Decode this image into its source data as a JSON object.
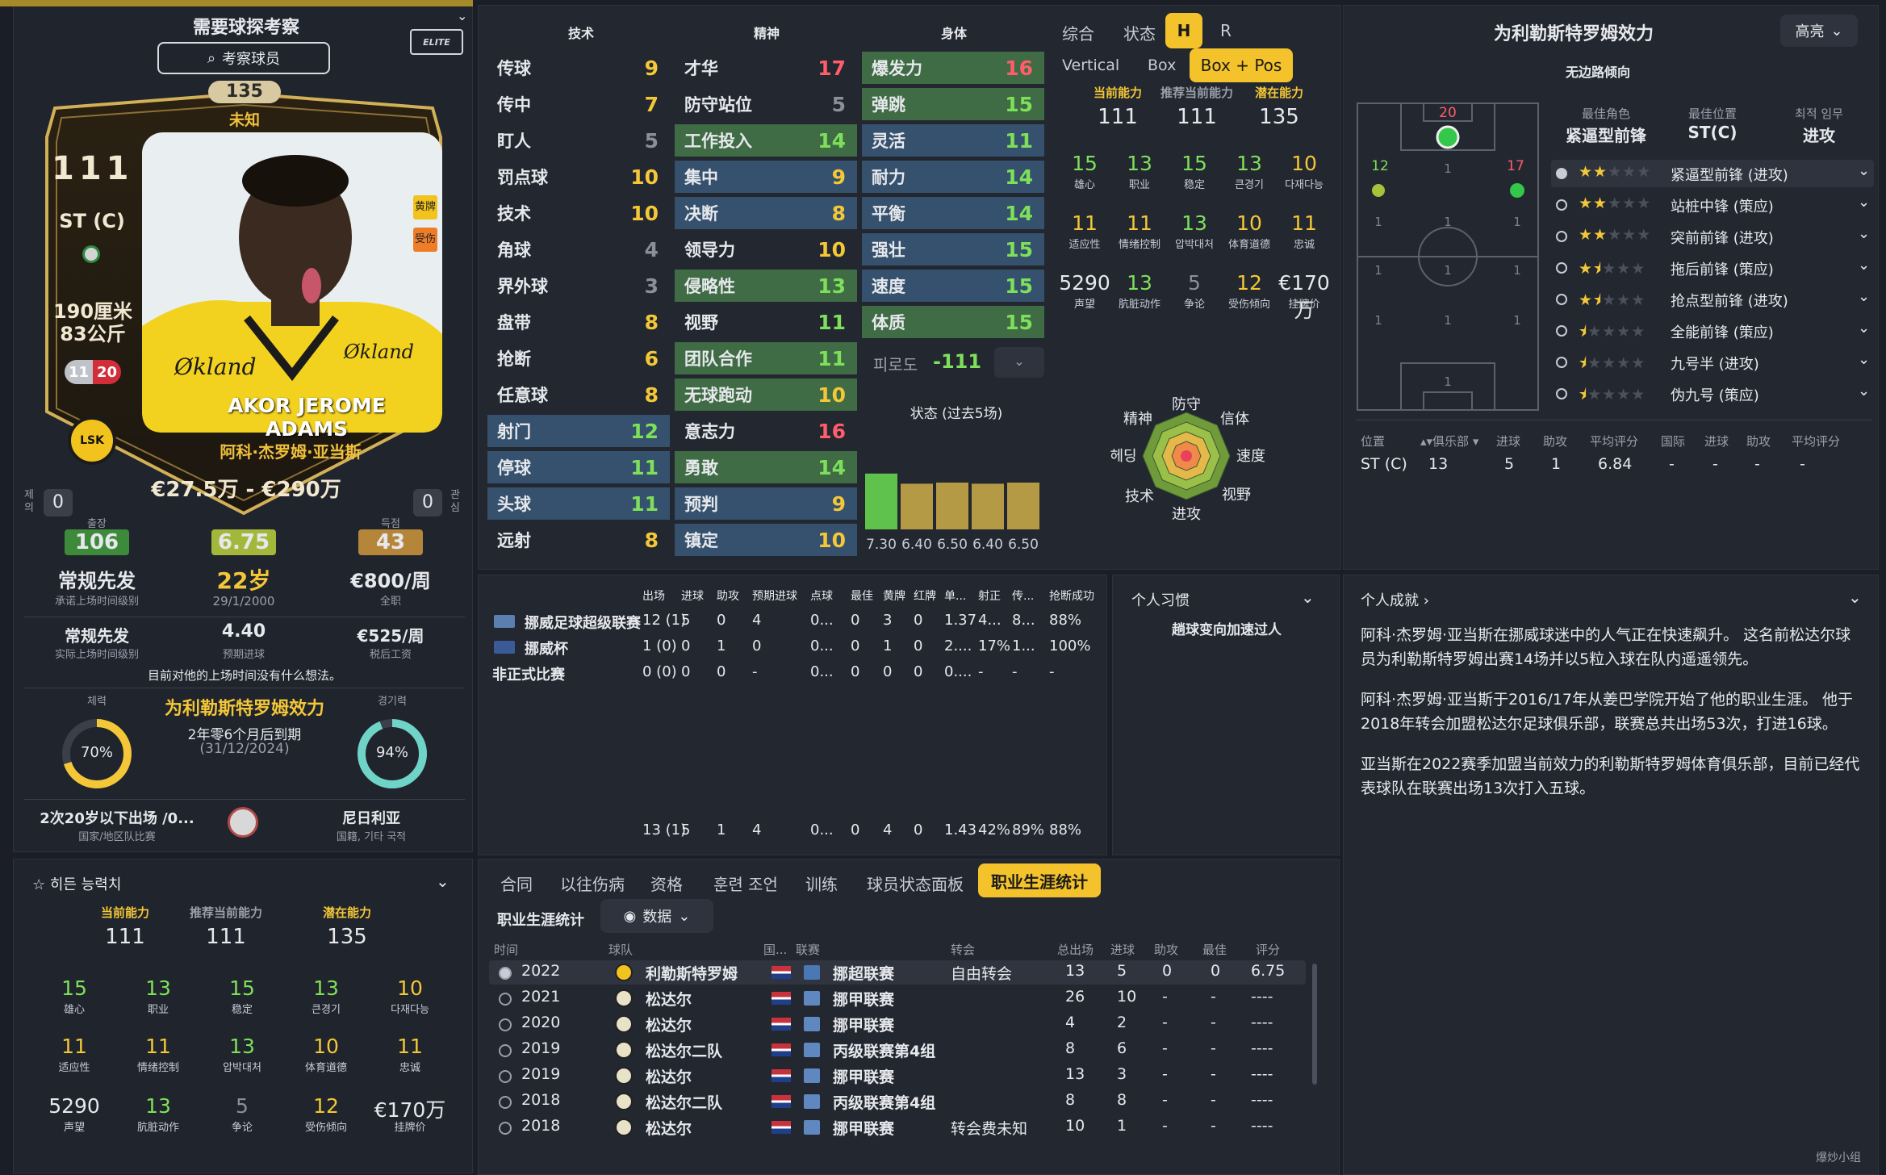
{
  "header": {
    "scout_title": "需要球探考察",
    "scout_button": "考察球员"
  },
  "card": {
    "top_number": "135",
    "status": "未知",
    "ca": "111",
    "position": "ST (C)",
    "height": "190厘米",
    "weight": "83公斤",
    "feet": "11",
    "feet2": "20",
    "name_banner": "AKOR JEROME ADAMS",
    "name_cn": "阿科·杰罗姆·亚当斯",
    "value": "€27.5万 - €290万",
    "badge_yellow": "黄牌",
    "badge_orange": "受伤",
    "club_abbr": "LSK",
    "left_count": "0",
    "right_count": "0",
    "left_side": "제의",
    "right_side": "관심"
  },
  "summary": {
    "apps_label": "출장",
    "apps": "106",
    "rating": "6.75",
    "goals_label": "득점",
    "goals": "43",
    "role": "常规先发",
    "role_sub": "承诺上场时间级别",
    "age": "22岁",
    "dob": "29/1/2000",
    "wage": "€800/周",
    "wage_sub": "全职",
    "role2": "常规先发",
    "role2_sub": "实际上场时间级别",
    "pred": "4.40",
    "pred_sub": "预期进球",
    "wage2": "€525/周",
    "wage2_sub": "税后工资",
    "note": "目前对他的上场时间没有什么想法。",
    "fitness_label": "체력",
    "fitness": "70%",
    "club_line": "为利勒斯特罗姆效力",
    "contract": "2年零6个月后到期",
    "contract_date": "(31/12/2024)",
    "sharp_label": "경기력",
    "sharpness": "94%",
    "u20": "2次20岁以下出场 /0...",
    "u20_sub": "国家/地区队比赛",
    "nation": "尼日利亚",
    "nation_sub": "国籍, 기타 국적"
  },
  "attributes": {
    "heads": [
      "技术",
      "精神",
      "身体"
    ],
    "technical": [
      [
        "传球",
        "9"
      ],
      [
        "传中",
        "7"
      ],
      [
        "盯人",
        "5"
      ],
      [
        "罚点球",
        "10"
      ],
      [
        "技术",
        "10"
      ],
      [
        "角球",
        "4"
      ],
      [
        "界外球",
        "3"
      ],
      [
        "盘带",
        "8"
      ],
      [
        "抢断",
        "6"
      ],
      [
        "任意球",
        "8"
      ],
      [
        "射门",
        "12"
      ],
      [
        "停球",
        "11"
      ],
      [
        "头球",
        "11"
      ],
      [
        "远射",
        "8"
      ]
    ],
    "mental": [
      [
        "才华",
        "17"
      ],
      [
        "防守站位",
        "5"
      ],
      [
        "工作投入",
        "14"
      ],
      [
        "集中",
        "9"
      ],
      [
        "决断",
        "8"
      ],
      [
        "领导力",
        "10"
      ],
      [
        "侵略性",
        "13"
      ],
      [
        "视野",
        "11"
      ],
      [
        "团队合作",
        "11"
      ],
      [
        "无球跑动",
        "10"
      ],
      [
        "意志力",
        "16"
      ],
      [
        "勇敢",
        "14"
      ],
      [
        "预判",
        "9"
      ],
      [
        "镇定",
        "10"
      ]
    ],
    "physical": [
      [
        "爆发力",
        "16"
      ],
      [
        "弹跳",
        "15"
      ],
      [
        "灵活",
        "11"
      ],
      [
        "耐力",
        "14"
      ],
      [
        "平衡",
        "14"
      ],
      [
        "强壮",
        "15"
      ],
      [
        "速度",
        "15"
      ],
      [
        "体质",
        "15"
      ]
    ],
    "fatigue_label": "피로도",
    "fatigue": "-111"
  },
  "mid_tabs": {
    "tabs": [
      "综合",
      "状态",
      "H",
      "R"
    ],
    "view": [
      "Vertical",
      "Box",
      "Box + Pos"
    ]
  },
  "ability": {
    "labels": [
      "当前能力",
      "推荐当前能力",
      "潜在能力"
    ],
    "values": [
      "111",
      "111",
      "135"
    ],
    "row1": [
      [
        "15",
        "雄心"
      ],
      [
        "13",
        "职业"
      ],
      [
        "15",
        "稳定"
      ],
      [
        "13",
        "큰경기"
      ],
      [
        "10",
        "다재다능"
      ]
    ],
    "row2": [
      [
        "11",
        "适应性"
      ],
      [
        "11",
        "情绪控制"
      ],
      [
        "13",
        "압박대처"
      ],
      [
        "10",
        "体育道德"
      ],
      [
        "11",
        "忠诚"
      ]
    ],
    "row3": [
      [
        "5290",
        "声望"
      ],
      [
        "13",
        "肮脏动作"
      ],
      [
        "5",
        "争论"
      ],
      [
        "12",
        "受伤倾向"
      ],
      [
        "€170万",
        "挂牌价"
      ]
    ]
  },
  "form": {
    "title": "状态 (过去5场)",
    "values": [
      "7.30",
      "6.40",
      "6.50",
      "6.40",
      "6.50"
    ]
  },
  "radar": {
    "labels": [
      "防守",
      "信体",
      "速度",
      "视野",
      "进攻",
      "技术",
      "헤딩",
      "精神"
    ]
  },
  "right": {
    "title": "为利勒斯特罗姆效力",
    "highlight": "高亮",
    "role_note": "无边路倾向",
    "best_role_label": "最佳角色",
    "best_role": "紧逼型前锋",
    "best_pos_label": "最佳位置",
    "best_pos": "ST(C)",
    "duty_label": "최적 임무",
    "duty": "进攻",
    "pitch_nums": {
      "st": "20",
      "aml": "12",
      "amr": "17"
    },
    "roles": [
      [
        "紧逼型前锋 (进攻)",
        2
      ],
      [
        "站桩中锋 (策应)",
        2
      ],
      [
        "突前前锋 (进攻)",
        2
      ],
      [
        "拖后前锋 (策应)",
        1.5
      ],
      [
        "抢点型前锋 (进攻)",
        1.5
      ],
      [
        "全能前锋 (策应)",
        0.5
      ],
      [
        "九号半 (进攻)",
        0.5
      ],
      [
        "伪九号 (策应)",
        0.5
      ]
    ],
    "pos_table_head": [
      "位置",
      "俱乐部",
      "进球",
      "助攻",
      "平均评分",
      "国际",
      "进球",
      "助攻",
      "平均评分"
    ],
    "pos_table_row": [
      "ST (C)",
      "13",
      "5",
      "1",
      "6.84",
      "-",
      "-",
      "-",
      "-"
    ]
  },
  "stats": {
    "head": [
      "出场",
      "进球",
      "助攻",
      "预期进球",
      "点球",
      "最佳",
      "黄牌",
      "红牌",
      "单...",
      "射正",
      "传...",
      "抢断成功"
    ],
    "rows": [
      [
        "挪威足球超级联赛",
        "12 (1)",
        "5",
        "0",
        "4",
        "0...",
        "0",
        "3",
        "0",
        "1.37",
        "4...",
        "8...",
        "88%"
      ],
      [
        "挪威杯",
        "1 (0)",
        "0",
        "1",
        "0",
        "0...",
        "0",
        "1",
        "0",
        "2....",
        "17%",
        "1...",
        "100%"
      ],
      [
        "非正式比赛",
        "0 (0)",
        "0",
        "0",
        "-",
        "0...",
        "0",
        "0",
        "0",
        "0....",
        "-",
        "-",
        "-"
      ]
    ],
    "total": [
      "13 (1)",
      "5",
      "1",
      "4",
      "0...",
      "0",
      "4",
      "0",
      "1.43",
      "42%",
      "89%",
      "88%"
    ]
  },
  "habits": {
    "title": "个人习惯",
    "item": "趟球变向加速过人"
  },
  "achieve": {
    "title": "个人成就 ›",
    "p1": "阿科·杰罗姆·亚当斯在挪威球迷中的人气正在快速飙升。 这名前松达尔球员为利勒斯特罗姆出赛14场并以5粒入球在队内遥遥领先。",
    "p2": "阿科·杰罗姆·亚当斯于2016/17年从姜巴学院开始了他的职业生涯。 他于2018年转会加盟松达尔足球俱乐部，联赛总共出场53次，打进16球。",
    "p3": "亚当斯在2022赛季加盟当前效力的利勒斯特罗姆体育俱乐部，目前已经代表球队在联赛出场13次打入五球。"
  },
  "hidden": {
    "title": "☆ 히든 능력치"
  },
  "career": {
    "tabs": [
      "合同",
      "以往伤病",
      "资格",
      "훈련 조언",
      "训练",
      "球员状态面板",
      "职业生涯统计"
    ],
    "sub_title": "职业生涯统计",
    "dropdown": "数据",
    "head": [
      "时间",
      "球队",
      "国...",
      "联赛",
      "转会",
      "总出场",
      "进球",
      "助攻",
      "最佳",
      "评分"
    ],
    "rows": [
      [
        "2022",
        "利勒斯特罗姆",
        "挪超联赛",
        "自由转会",
        "13",
        "5",
        "0",
        "0",
        "6.75"
      ],
      [
        "2021",
        "松达尔",
        "挪甲联赛",
        "",
        "26",
        "10",
        "-",
        "-",
        "----"
      ],
      [
        "2020",
        "松达尔",
        "挪甲联赛",
        "",
        "4",
        "2",
        "-",
        "-",
        "----"
      ],
      [
        "2019",
        "松达尔二队",
        "丙级联赛第4组",
        "",
        "8",
        "6",
        "-",
        "-",
        "----"
      ],
      [
        "2019",
        "松达尔",
        "挪甲联赛",
        "",
        "13",
        "3",
        "-",
        "-",
        "----"
      ],
      [
        "2018",
        "松达尔二队",
        "丙级联赛第4组",
        "",
        "8",
        "8",
        "-",
        "-",
        "----"
      ],
      [
        "2018",
        "松达尔",
        "挪甲联赛",
        "转会费未知",
        "10",
        "1",
        "-",
        "-",
        "----"
      ]
    ]
  },
  "watermark": "爆炒小组"
}
